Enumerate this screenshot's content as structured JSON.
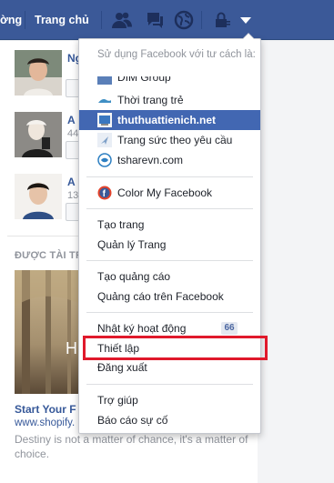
{
  "topbar": {
    "nav_link_partial": "ờng",
    "nav_link_home": "Trang chủ",
    "icons": [
      "friends-icon",
      "messages-icon",
      "notifications-globe-icon",
      "privacy-shortcuts-icon",
      "account-menu-arrow-icon"
    ]
  },
  "background_page": {
    "people": [
      {
        "name": "Ng",
        "sub": ""
      },
      {
        "name": "A",
        "sub": "44"
      },
      {
        "name": "A",
        "sub": "13"
      }
    ],
    "sponsored_label": "ĐƯỢC TÀI TR",
    "ad": {
      "image_text": "H",
      "title": "Start Your F",
      "url": "www.shopify.",
      "description": "Destiny is not a matter of chance, it's a matter of choice."
    }
  },
  "menu": {
    "header": "Sử dụng Facebook với tư cách là:",
    "pages": [
      {
        "label": "DIM Group",
        "icon": "page-thumbnail-icon"
      },
      {
        "label": "Thời trang trẻ",
        "icon": "page-thumbnail-icon"
      },
      {
        "label": "thuthuattienich.net",
        "icon": "page-thumbnail-icon"
      },
      {
        "label": "Trang sức theo yêu cầu",
        "icon": "page-thumbnail-icon"
      },
      {
        "label": "tsharevn.com",
        "icon": "page-thumbnail-icon"
      }
    ],
    "app": {
      "label": "Color My Facebook",
      "icon": "color-my-facebook-icon"
    },
    "items": {
      "create_page": "Tạo trang",
      "manage_pages": "Quản lý Trang",
      "create_ad": "Tạo quảng cáo",
      "ads_on_facebook": "Quảng cáo trên Facebook",
      "activity_log": "Nhật ký hoạt động",
      "activity_log_count": "66",
      "settings": "Thiết lập",
      "log_out": "Đăng xuất",
      "help": "Trợ giúp",
      "report_problem": "Báo cáo sự cố"
    }
  },
  "colors": {
    "facebook_blue": "#3b5998",
    "selected_item": "#4267b2",
    "highlight_box": "#e0192b"
  }
}
